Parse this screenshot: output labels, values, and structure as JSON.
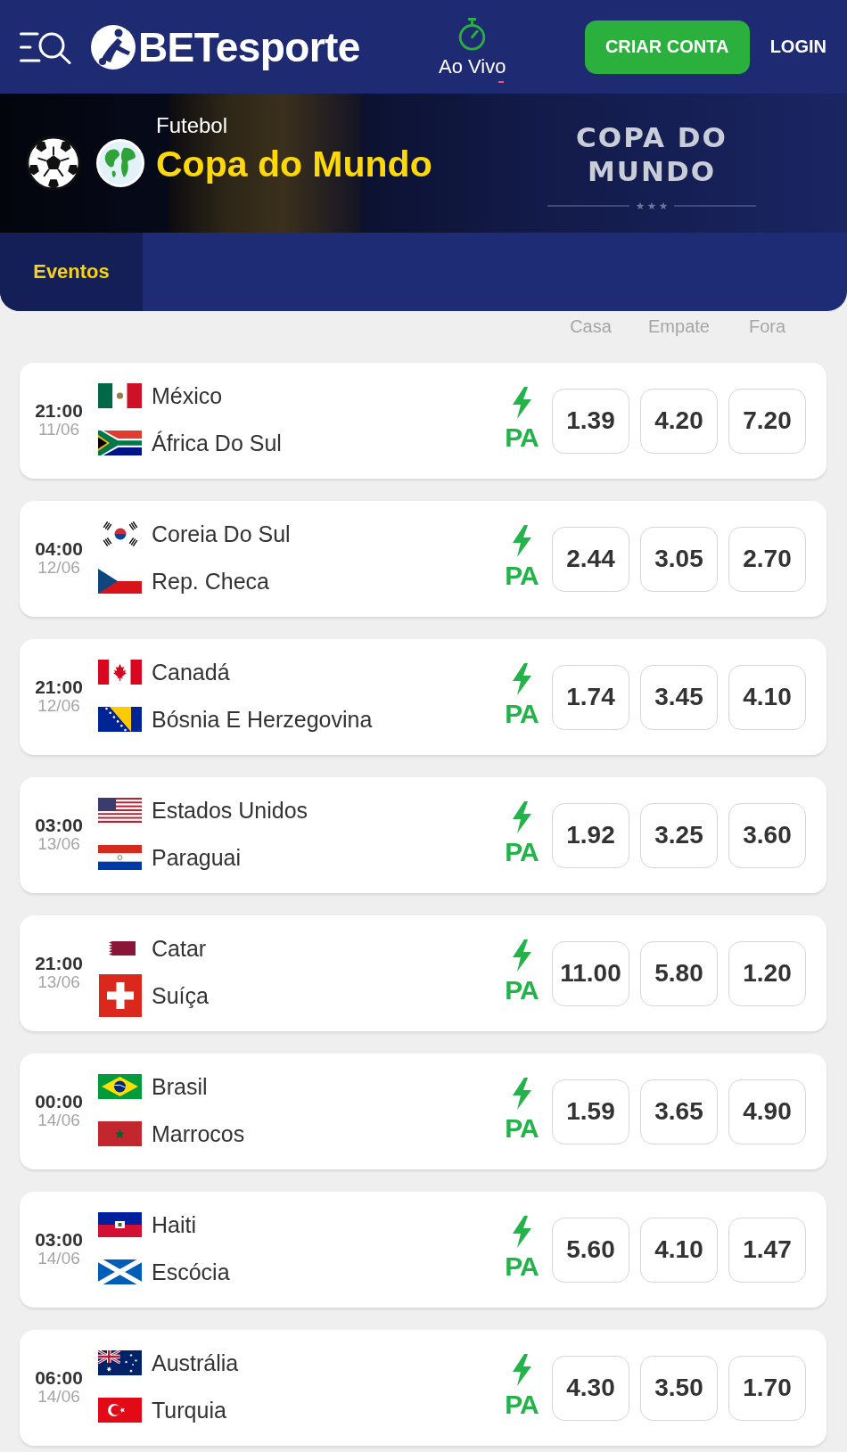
{
  "header": {
    "logo_text": "BETesporte",
    "live_link": "Ao Vivo",
    "signup_button": "CRIAR CONTA",
    "login_link": "LOGIN"
  },
  "banner": {
    "sport": "Futebol",
    "title": "Copa do Mundo",
    "logo_lines": [
      "COPA DO",
      "MUNDO"
    ]
  },
  "tabs": [
    {
      "label": "Eventos",
      "selected": true
    }
  ],
  "columns": [
    "Casa",
    "Empate",
    "Fora"
  ],
  "matches": [
    {
      "time": "21:00",
      "date": "11/06",
      "teams": [
        {
          "name": "México",
          "kind": "mexico"
        },
        {
          "name": "África Do Sul",
          "kind": "southafrica"
        }
      ],
      "badge": "PA",
      "odds": [
        "1.39",
        "4.20",
        "7.20"
      ]
    },
    {
      "time": "04:00",
      "date": "12/06",
      "teams": [
        {
          "name": "Coreia Do Sul",
          "kind": "korea"
        },
        {
          "name": "Rep. Checa",
          "kind": "czechia"
        }
      ],
      "badge": "PA",
      "odds": [
        "2.44",
        "3.05",
        "2.70"
      ]
    },
    {
      "time": "21:00",
      "date": "12/06",
      "teams": [
        {
          "name": "Canadá",
          "kind": "canada"
        },
        {
          "name": "Bósnia E Herzegovina",
          "kind": "bosnia"
        }
      ],
      "badge": "PA",
      "odds": [
        "1.74",
        "3.45",
        "4.10"
      ]
    },
    {
      "time": "03:00",
      "date": "13/06",
      "teams": [
        {
          "name": "Estados Unidos",
          "kind": "usa"
        },
        {
          "name": "Paraguai",
          "kind": "paraguay"
        }
      ],
      "badge": "PA",
      "odds": [
        "1.92",
        "3.25",
        "3.60"
      ]
    },
    {
      "time": "21:00",
      "date": "13/06",
      "teams": [
        {
          "name": "Catar",
          "kind": "qatar"
        },
        {
          "name": "Suíça",
          "kind": "switzerland"
        }
      ],
      "badge": "PA",
      "odds": [
        "11.00",
        "5.80",
        "1.20"
      ]
    },
    {
      "time": "00:00",
      "date": "14/06",
      "teams": [
        {
          "name": "Brasil",
          "kind": "brazil"
        },
        {
          "name": "Marrocos",
          "kind": "morocco"
        }
      ],
      "badge": "PA",
      "odds": [
        "1.59",
        "3.65",
        "4.90"
      ]
    },
    {
      "time": "03:00",
      "date": "14/06",
      "teams": [
        {
          "name": "Haiti",
          "kind": "haiti"
        },
        {
          "name": "Escócia",
          "kind": "scotland"
        }
      ],
      "badge": "PA",
      "odds": [
        "5.60",
        "4.10",
        "1.47"
      ]
    },
    {
      "time": "06:00",
      "date": "14/06",
      "teams": [
        {
          "name": "Austrália",
          "kind": "australia"
        },
        {
          "name": "Turquia",
          "kind": "turkey"
        }
      ],
      "badge": "PA",
      "odds": [
        "4.30",
        "3.50",
        "1.70"
      ]
    }
  ]
}
